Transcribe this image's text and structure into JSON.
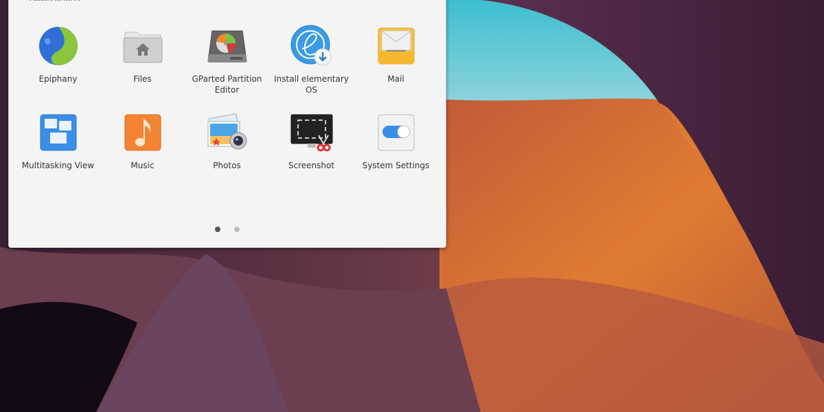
{
  "launcher": {
    "category_label_partial": "Applications",
    "apps": [
      {
        "name": "Epiphany",
        "icon": "epiphany-browser-icon"
      },
      {
        "name": "Files",
        "icon": "files-folder-icon"
      },
      {
        "name": "GParted Partition Editor",
        "icon": "gparted-disk-icon"
      },
      {
        "name": "Install elementary OS",
        "icon": "install-elementary-icon"
      },
      {
        "name": "Mail",
        "icon": "mail-icon"
      },
      {
        "name": "Multitasking View",
        "icon": "multitasking-view-icon"
      },
      {
        "name": "Music",
        "icon": "music-note-icon"
      },
      {
        "name": "Photos",
        "icon": "photos-icon"
      },
      {
        "name": "Screenshot",
        "icon": "screenshot-icon"
      },
      {
        "name": "System Settings",
        "icon": "settings-toggle-icon"
      }
    ],
    "pages": {
      "current": 1,
      "total": 2
    }
  },
  "colors": {
    "panel_bg": "#f4f4f4",
    "label_text": "#333333",
    "dot_active": "#555555",
    "dot_inactive": "#bbbbbb",
    "sky": "#4cc3d3",
    "rock_orange": "#d8722c",
    "rock_purple": "#5e3550"
  }
}
